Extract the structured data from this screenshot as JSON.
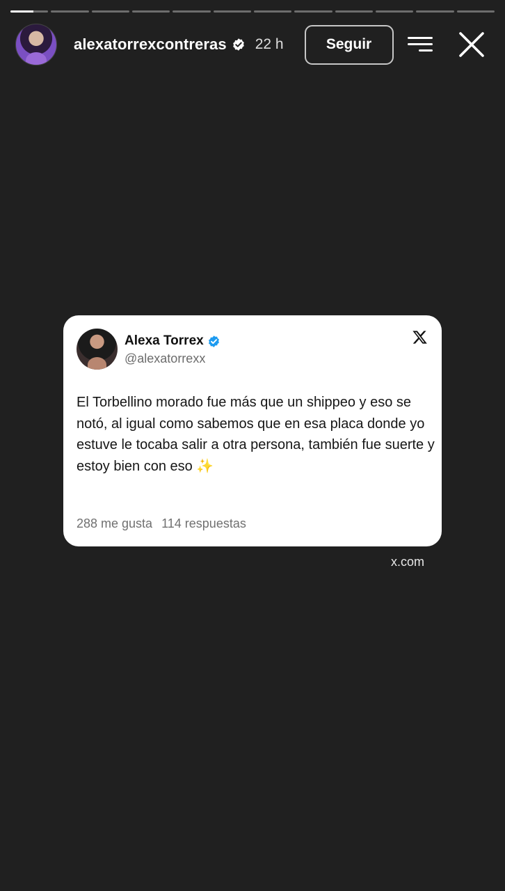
{
  "story": {
    "progress_segments": [
      0.6,
      0,
      0,
      0,
      0,
      0,
      0,
      0,
      0,
      0,
      0,
      0
    ],
    "username": "alexatorrexcontreras",
    "time_ago": "22 h",
    "follow_label": "Seguir"
  },
  "tweet": {
    "display_name": "Alexa Torrex",
    "handle": "@alexatorrexx",
    "text": "El Torbellino morado fue más que un shippeo y eso se notó, al igual como sabemos que en esa placa donde yo estuve le tocaba salir a otra persona, también fue suerte y estoy bien con eso ✨",
    "likes": "288 me gusta",
    "replies": "114 respuestas"
  },
  "source_label": "x.com",
  "colors": {
    "background": "#202020",
    "card": "#ffffff",
    "verified_blue": "#1d9bf0"
  }
}
